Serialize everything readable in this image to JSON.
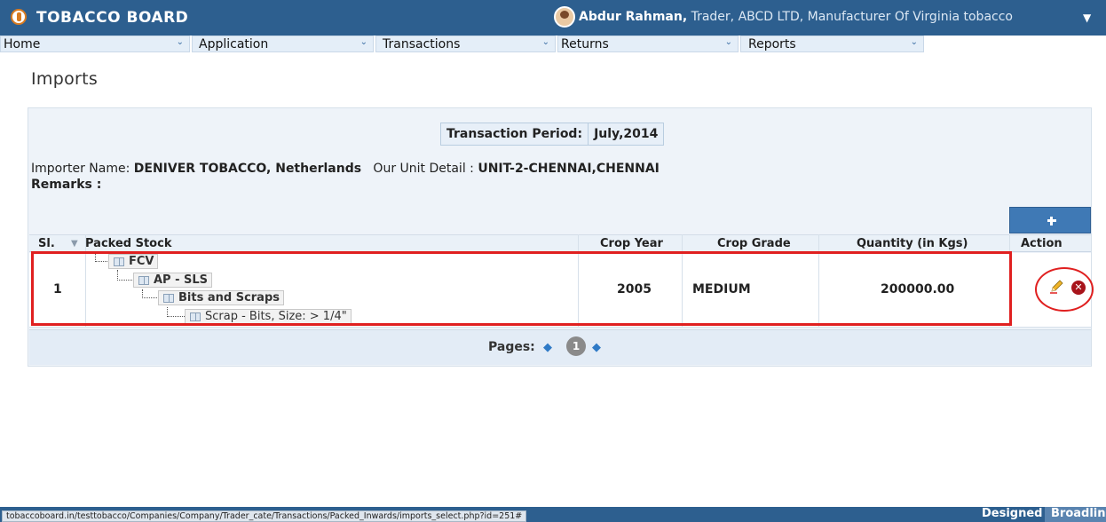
{
  "header": {
    "brand": "TOBACCO BOARD",
    "user_name": "Abdur Rahman,",
    "user_detail": " Trader, ABCD LTD, Manufacturer Of Virginia tobacco",
    "user_menu_icon": "caret-down-icon"
  },
  "menu": {
    "items": [
      {
        "label": "Home"
      },
      {
        "label": "Application"
      },
      {
        "label": "Transactions"
      },
      {
        "label": "Returns"
      },
      {
        "label": "Reports"
      }
    ]
  },
  "page": {
    "title": "Imports"
  },
  "transaction": {
    "period_label": "Transaction Period:",
    "period_value": "July,2014",
    "importer_label": "Importer Name:",
    "importer_value": "DENIVER TOBACCO, Netherlands",
    "unit_label": "Our Unit Detail :",
    "unit_value": "UNIT-2-CHENNAI,CHENNAI",
    "remarks_label": "Remarks :"
  },
  "table": {
    "columns": {
      "sl": "Sl.",
      "packed_stock": "Packed Stock",
      "crop_year": "Crop Year",
      "crop_grade": "Crop Grade",
      "quantity": "Quantity (in Kgs)",
      "action": "Action"
    },
    "rows": [
      {
        "sl": "1",
        "tree": [
          "FCV",
          "AP - SLS",
          "Bits and Scraps",
          "Scrap - Bits, Size: > 1/4\""
        ],
        "crop_year": "2005",
        "crop_grade": "MEDIUM",
        "quantity": "200000.00"
      }
    ]
  },
  "pager": {
    "label": "Pages:",
    "current": "1"
  },
  "footer": {
    "status_url": "tobaccoboard.in/testtobacco/Companies/Company/Trader_cate/Transactions/Packed_Inwards/imports_select.php?id=251#",
    "designed_by": "Designed by:",
    "designer": "Broadline"
  },
  "colors": {
    "header_blue": "#2d5f8f",
    "highlight_red": "#e02020",
    "add_button": "#3f79b5"
  }
}
